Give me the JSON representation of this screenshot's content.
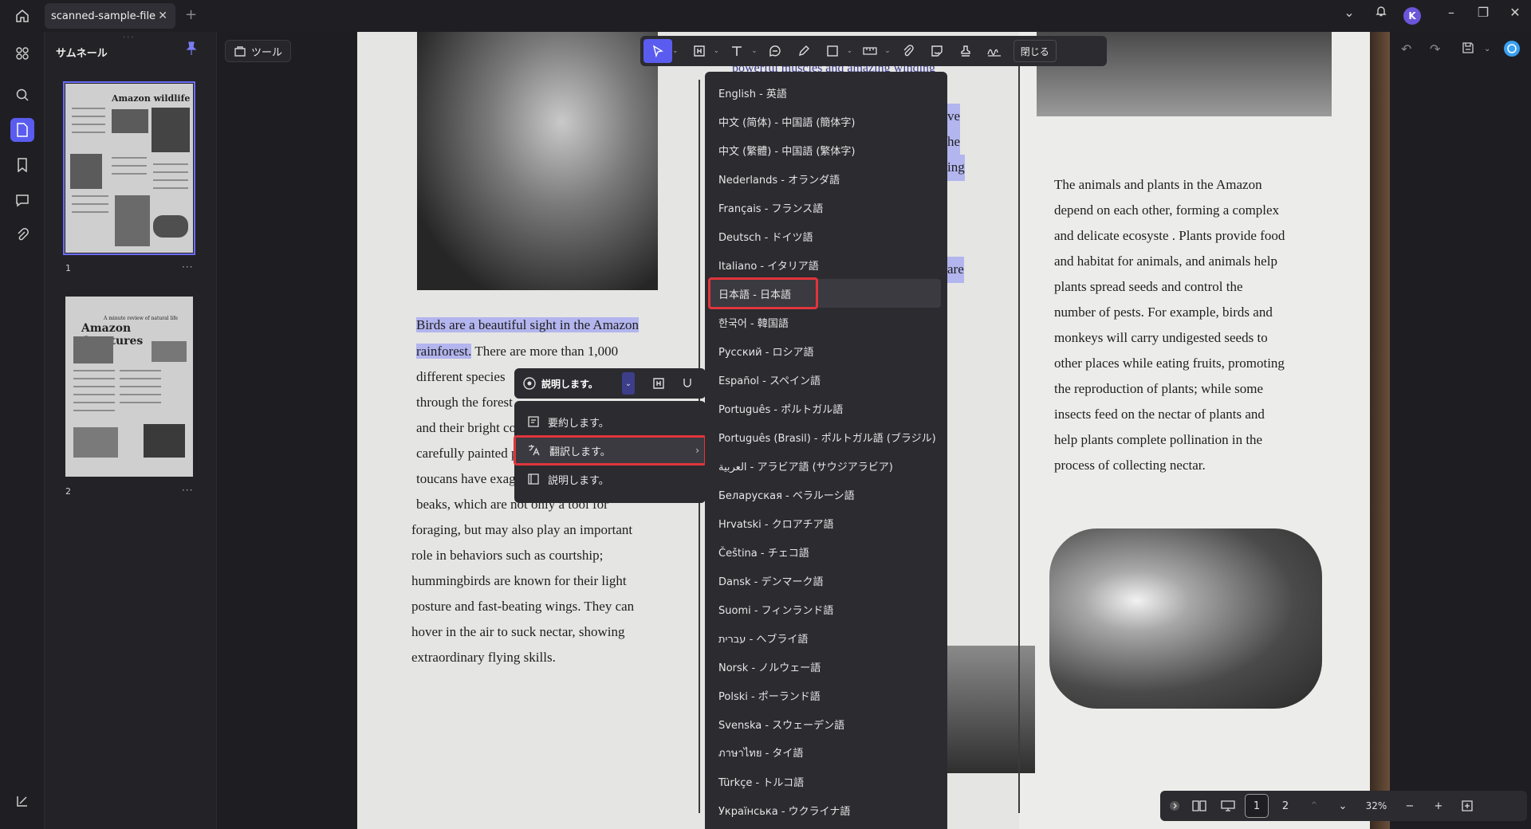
{
  "titlebar": {
    "tab_label": "scanned-sample-file",
    "close_glyph": "✕",
    "new_tab_glyph": "+",
    "avatar_letter": "K"
  },
  "thumbnails": {
    "title": "サムネール",
    "pages": [
      {
        "number": "1",
        "heading": "Amazon wildlife"
      },
      {
        "number": "2",
        "kicker": "A minute review of natural life",
        "heading": "Amazon Creatures"
      }
    ],
    "more_glyph": "···"
  },
  "tools": {
    "label": "ツール"
  },
  "annotation_toolbar": {
    "close_label": "閉じる"
  },
  "document": {
    "left_highlight": "Birds are a beautiful sight in the Amazon rainforest.",
    "left_lines": [
      "There are more than 1,000",
      "different species",
      "through the forest",
      "and their bright co",
      "carefully painted p",
      "toucans have exag",
      "beaks, which are not only a tool for",
      "foraging, but may also play an important",
      "role in behaviors such as courtship;",
      "hummingbirds are known for their light",
      "posture and fast-beating wings. They can",
      "hover in the air to suck nectar, showing",
      "extraordinary flying skills."
    ],
    "top_fragment": "powerful muscles and amazing winding",
    "right_lines": [
      "The animals and plants in the Amazon",
      "depend on each other, forming a complex",
      "and delicate ecosyste  . Plants provide food",
      "and habitat for animals, and animals help",
      "plants spread seeds and control the",
      "number of pests. For example, birds and",
      "monkeys will carry undigested seeds to",
      "other places while eating fruits, promoting",
      "the reproduction of plants; while some",
      "insects feed on the nectar of plants and",
      "help plants complete pollination in the",
      "process of collecting nectar."
    ],
    "fragments": [
      "ve",
      "he",
      "ing",
      "are"
    ]
  },
  "ai_popup": {
    "main_label": "説明します。",
    "items": [
      {
        "label": "要約します。",
        "icon": "summary-icon"
      },
      {
        "label": "翻訳します。",
        "icon": "translate-icon"
      },
      {
        "label": "説明します。",
        "icon": "explain-icon"
      }
    ]
  },
  "languages": [
    "English - 英語",
    "中文 (简体) - 中国語 (簡体字)",
    "中文 (繁體) - 中国語 (繁体字)",
    "Nederlands - オランダ語",
    "Français - フランス語",
    "Deutsch - ドイツ語",
    "Italiano - イタリア語",
    "日本語 - 日本語",
    "한국어 - 韓国語",
    "Русский - ロシア語",
    "Español - スペイン語",
    "Português - ポルトガル語",
    "Português (Brasil) - ポルトガル語 (ブラジル)",
    "العربية - アラビア語 (サウジアラビア)",
    "Беларуская - ベラルーシ語",
    "Hrvatski - クロアチア語",
    "Čeština - チェコ語",
    "Dansk - デンマーク語",
    "Suomi - フィンランド語",
    "עברית - ヘブライ語",
    "Norsk - ノルウェー語",
    "Polski - ポーランド語",
    "Svenska - スウェーデン語",
    "ภาษาไทย - タイ語",
    "Türkçe - トルコ語",
    "Українська - ウクライナ語"
  ],
  "selected_language_index": 7,
  "bottom_nav": {
    "page_1": "1",
    "page_2": "2",
    "zoom": "32%",
    "minus": "−",
    "plus": "+"
  },
  "colors": {
    "accent": "#5a5cf0",
    "highlight_box": "#e0353b",
    "text_highlight": "#b3b5ee"
  }
}
